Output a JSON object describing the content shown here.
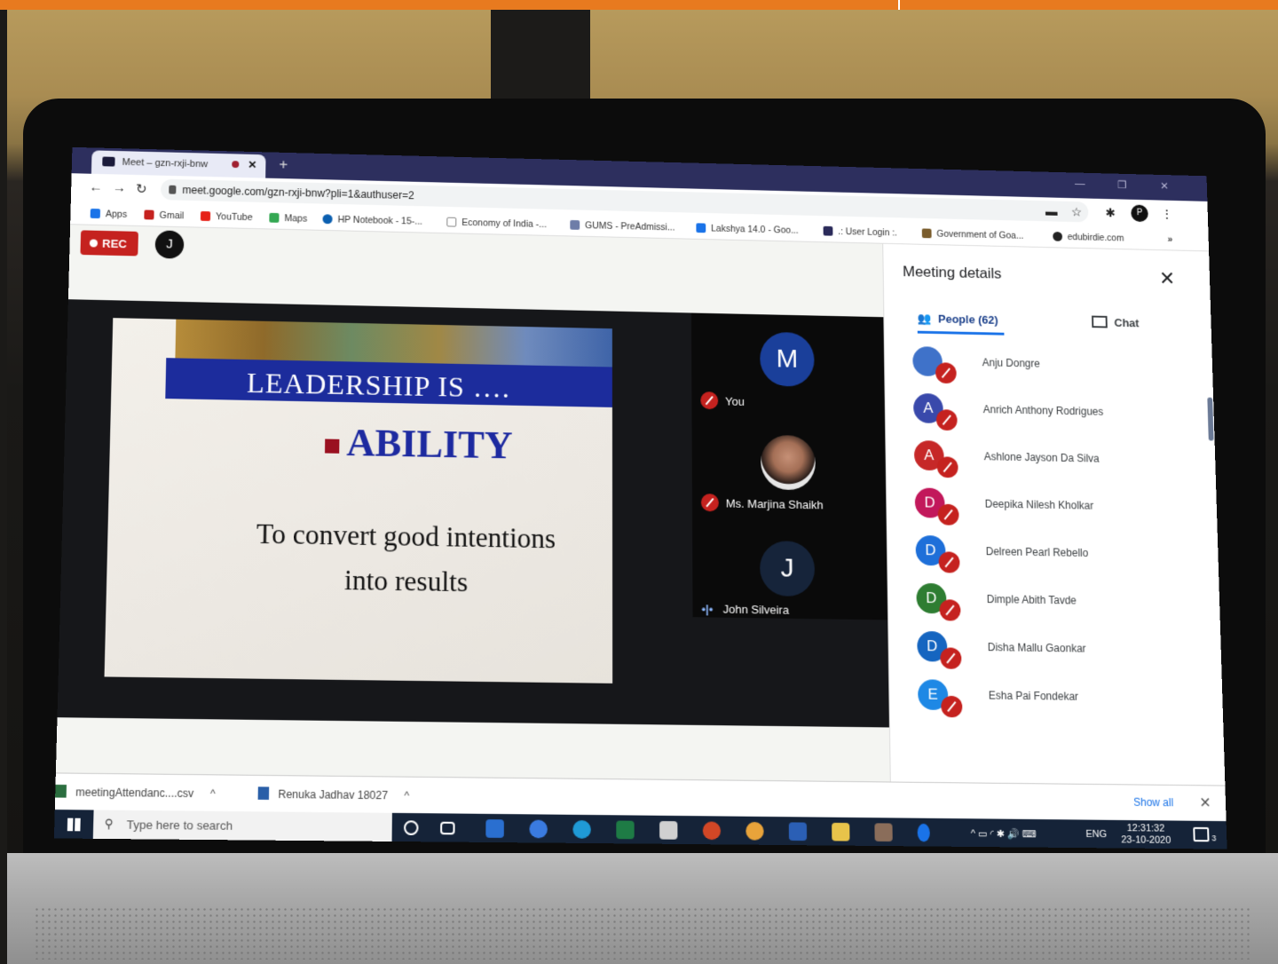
{
  "browser": {
    "tab_title": "Meet – gzn-rxji-bnw",
    "url": "meet.google.com/gzn-rxji-bnw?pli=1&authuser=2",
    "profile_initial": "P",
    "bookmarks": [
      "Apps",
      "Gmail",
      "YouTube",
      "Maps",
      "HP Notebook - 15-...",
      "Economy of India -...",
      "GUMS - PreAdmissi...",
      "Lakshya 14.0 - Goo...",
      ".: User Login :.",
      "Government of Goa...",
      "edubirdie.com"
    ],
    "bookmark_overflow": "»"
  },
  "meet": {
    "rec_label": "REC",
    "top_avatar_initial": "J",
    "slide": {
      "title": "LEADERSHIP IS ….",
      "headline": "ABILITY",
      "body_line1": "To convert good intentions",
      "body_line2": "into results"
    },
    "tiles": [
      {
        "initial": "M",
        "name": "You"
      },
      {
        "initial": "",
        "name": "Ms. Marjina Shaikh"
      },
      {
        "initial": "J",
        "name": "John Silveira"
      }
    ]
  },
  "panel": {
    "title": "Meeting details",
    "tab_people": "People (62)",
    "tab_chat": "Chat",
    "people": [
      {
        "initial": "",
        "name": "Anju Dongre",
        "color": "#3f72c9"
      },
      {
        "initial": "A",
        "name": "Anrich Anthony Rodrigues",
        "color": "#3949ab"
      },
      {
        "initial": "A",
        "name": "Ashlone Jayson Da Silva",
        "color": "#c62828"
      },
      {
        "initial": "D",
        "name": "Deepika Nilesh Kholkar",
        "color": "#c2185b"
      },
      {
        "initial": "D",
        "name": "Delreen Pearl Rebello",
        "color": "#1e6fd9"
      },
      {
        "initial": "D",
        "name": "Dimple Abith Tavde",
        "color": "#2e7d32"
      },
      {
        "initial": "D",
        "name": "Disha Mallu Gaonkar",
        "color": "#1565c0"
      },
      {
        "initial": "E",
        "name": "Esha Pai Fondekar",
        "color": "#1e88e5"
      }
    ]
  },
  "downloads": {
    "file1": "meetingAttendanc....csv",
    "file2": "Renuka Jadhav 18027",
    "show_all": "Show all"
  },
  "taskbar": {
    "search_placeholder": "Type here to search",
    "language": "ENG",
    "time": "12:31:32",
    "date": "23-10-2020",
    "notification_count": "3"
  }
}
